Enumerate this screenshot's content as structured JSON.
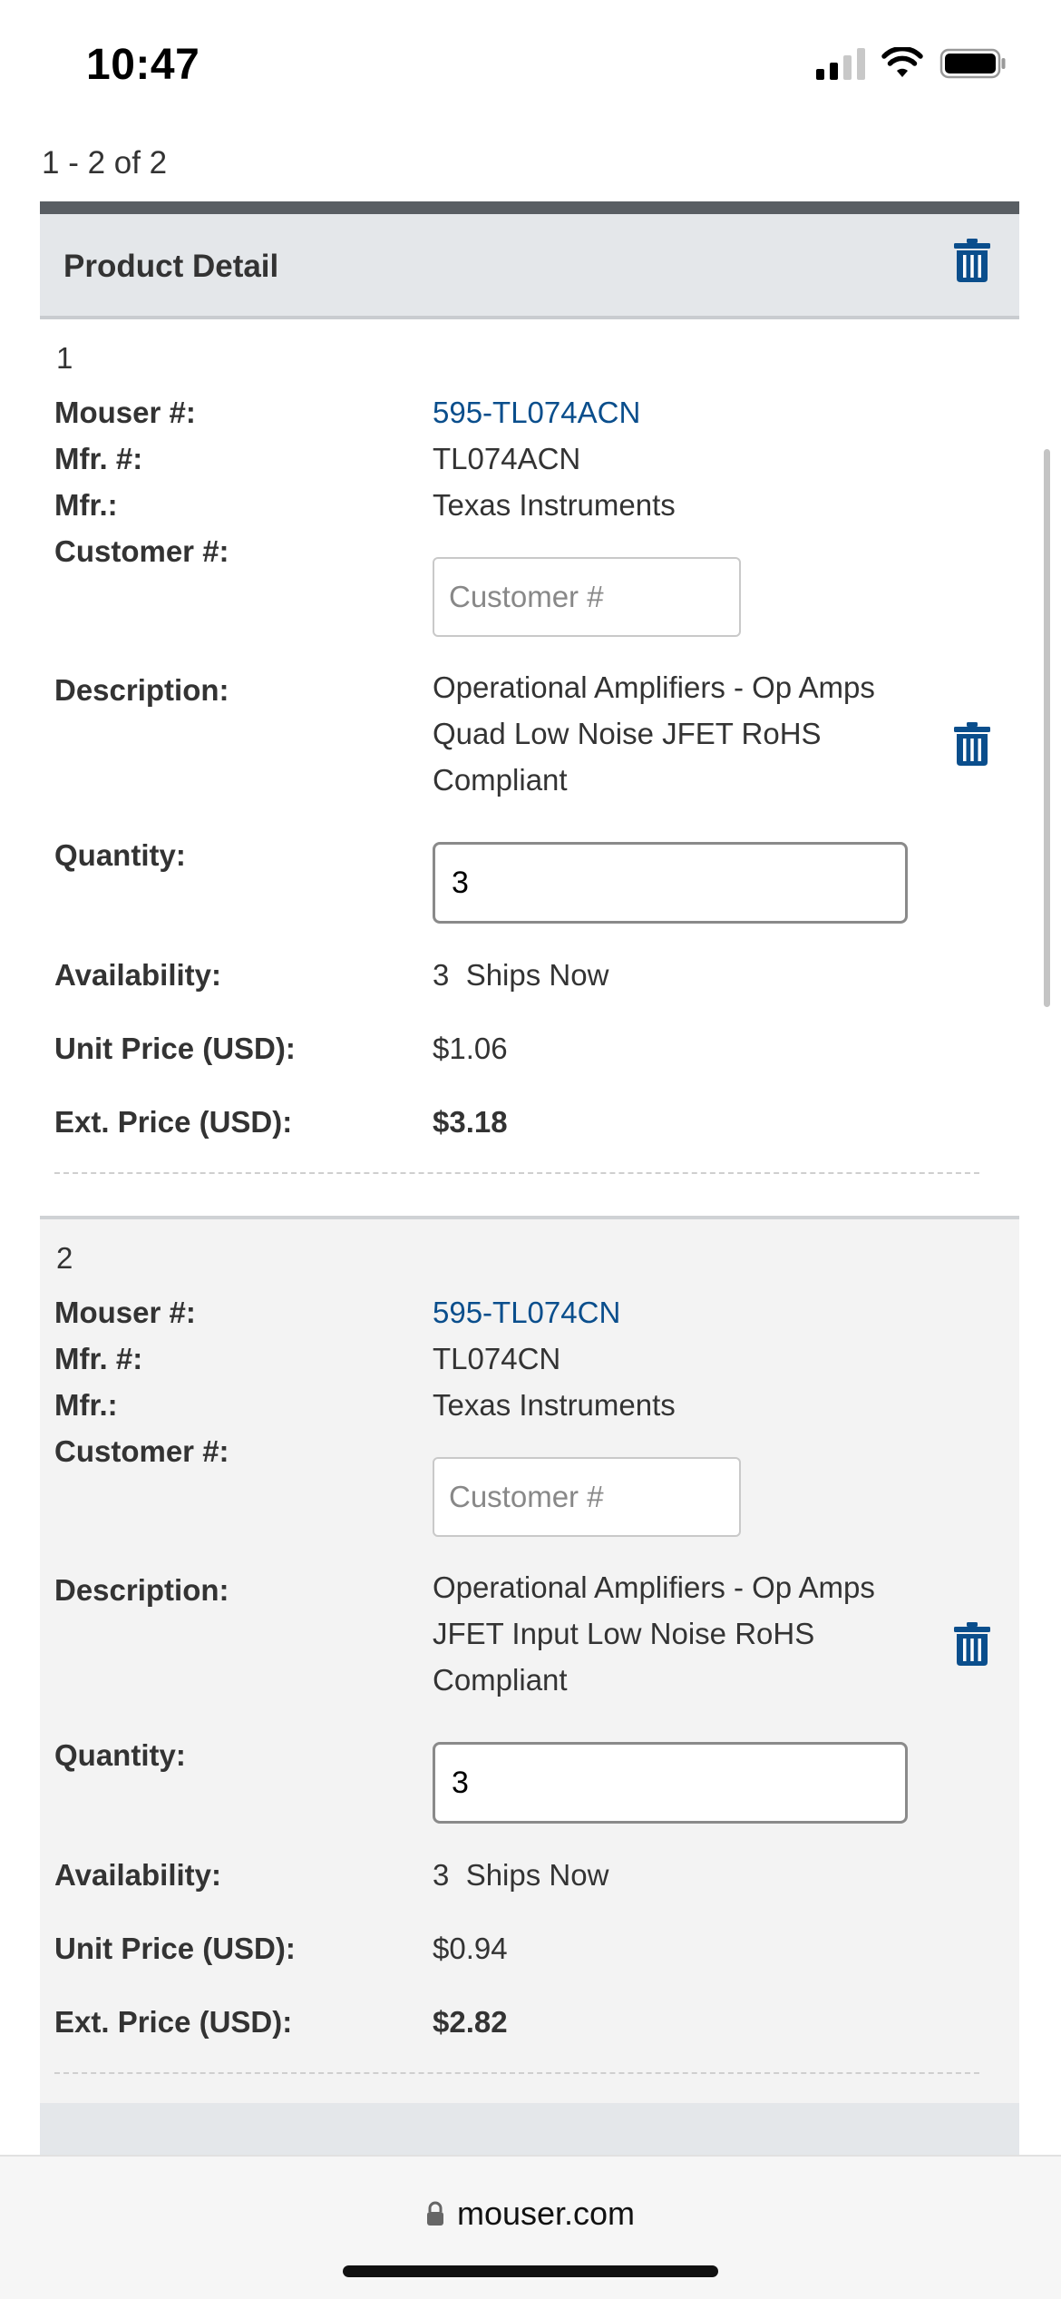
{
  "status_bar": {
    "time": "10:47"
  },
  "pager": {
    "text": "1 - 2 of 2"
  },
  "header": {
    "title": "Product Detail"
  },
  "labels": {
    "mouser": "Mouser #:",
    "mfr_num": "Mfr. #:",
    "mfr": "Mfr.:",
    "customer": "Customer #:",
    "description": "Description:",
    "quantity": "Quantity:",
    "availability": "Availability:",
    "unit_price": "Unit Price (USD):",
    "ext_price": "Ext. Price (USD):"
  },
  "customer_placeholder": "Customer #",
  "items": [
    {
      "index": "1",
      "mouser_number": "595-TL074ACN",
      "mfr_number": "TL074ACN",
      "mfr": "Texas Instruments",
      "description": "Operational Amplifiers - Op Amps Quad Low Noise JFET RoHS Compliant",
      "quantity": "3",
      "availability": "3  Ships Now",
      "unit_price": "$1.06",
      "ext_price": "$3.18"
    },
    {
      "index": "2",
      "mouser_number": "595-TL074CN",
      "mfr_number": "TL074CN",
      "mfr": "Texas Instruments",
      "description": "Operational Amplifiers - Op Amps JFET Input Low Noise RoHS Compliant",
      "quantity": "3",
      "availability": "3  Ships Now",
      "unit_price": "$0.94",
      "ext_price": "$2.82"
    }
  ],
  "browser": {
    "url": "mouser.com"
  },
  "colors": {
    "link": "#0a4e8c",
    "trash": "#0a4e8c",
    "header_bg": "#e4e7ea",
    "header_border": "#595e63"
  },
  "icons": [
    "trash-icon",
    "lock-icon",
    "signal-icon",
    "wifi-icon",
    "battery-icon"
  ]
}
